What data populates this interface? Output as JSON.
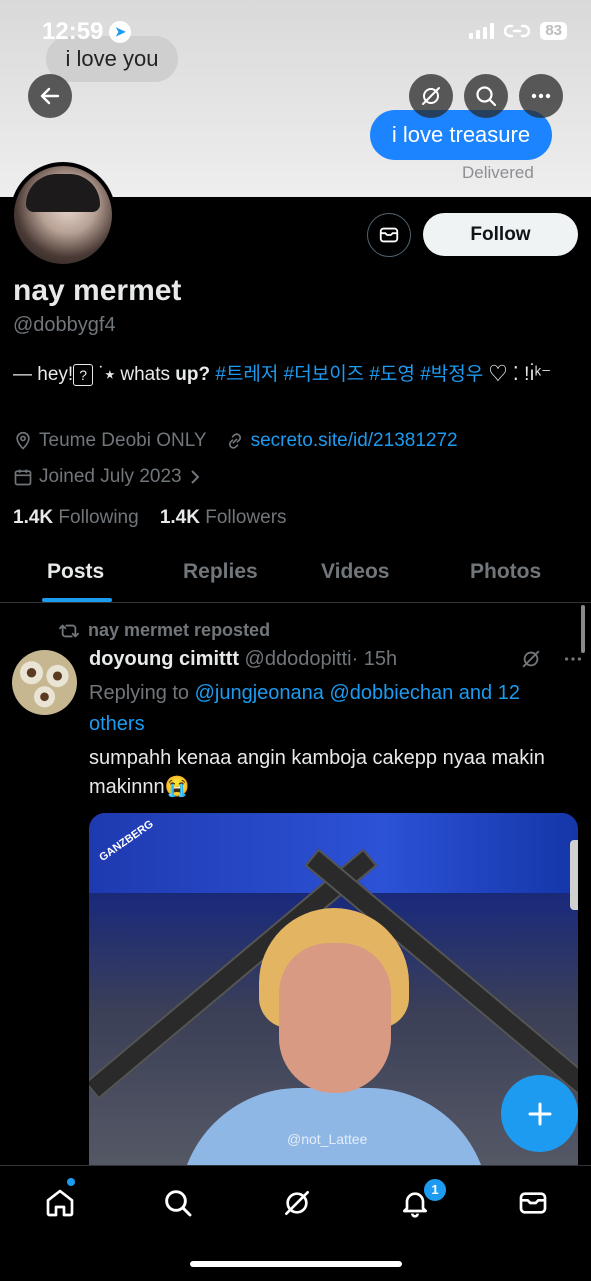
{
  "status": {
    "time": "12:59",
    "battery": "83"
  },
  "banner": {
    "bubble_left": "i love you",
    "bubble_right": "i love treasure",
    "delivered": "Delivered"
  },
  "profile": {
    "name": "nay mermet",
    "handle": "@dobbygf4",
    "follow_label": "Follow",
    "bio_prefix": "— hey!",
    "bio_box": "?",
    "bio_mid": " ˙⭑ whats ",
    "bio_up": "up?",
    "bio_tags": "#트레저 #더보이즈 #도영 #박정우",
    "bio_suffix": " ♡ ⁚ !ı̇ᵏ⁻",
    "location": "Teume Deobi ONLY",
    "link": "secreto.site/id/21381272",
    "joined": "Joined July 2023",
    "following_count": "1.4K",
    "following_label": "Following",
    "followers_count": "1.4K",
    "followers_label": "Followers"
  },
  "tabs": [
    "Posts",
    "Replies",
    "Videos",
    "Photos"
  ],
  "post": {
    "repost_label": "nay mermet reposted",
    "author_name": "doyoung cimittt",
    "author_handle": "@ddodopitti",
    "time": "· 15h",
    "replying_prefix": "Replying to ",
    "mentions": "@jungjeonana @dobbiechan and 12 others",
    "text": "sumpahh kenaa angin kamboja cakepp nyaa makin makinnn😭",
    "media_watermark": "@not_Lattee",
    "media_brand": "GANZBERG"
  },
  "nav": {
    "notif_count": "1"
  },
  "colors": {
    "accent": "#1d9bf0",
    "background": "#000000",
    "muted": "#71767b"
  }
}
